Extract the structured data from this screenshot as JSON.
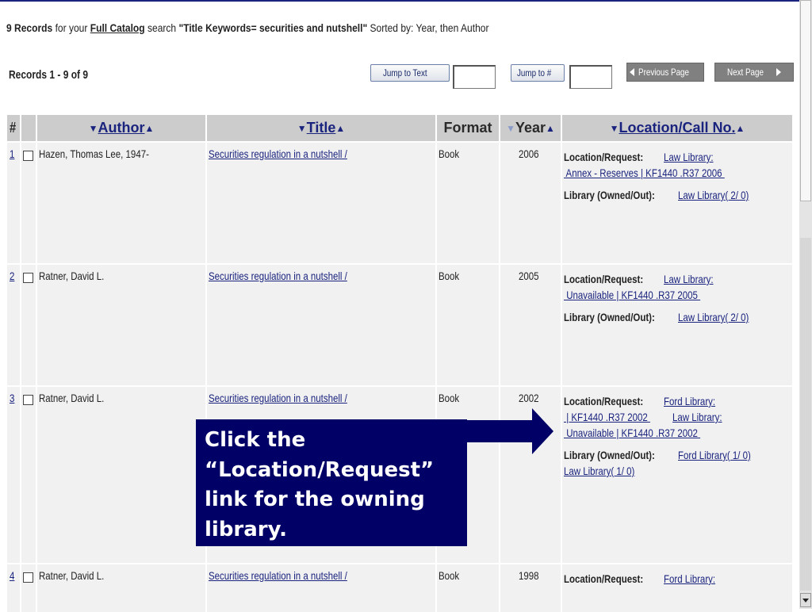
{
  "summary": {
    "count": "9 Records",
    "for_your": "for your",
    "catalog": "Full Catalog",
    "search": "search",
    "query": "\"Title Keywords= securities and nutshell\"",
    "sorted": "Sorted by: Year, then Author"
  },
  "records_range": "Records 1 - 9 of 9",
  "controls": {
    "jump_text": "Jump to Text",
    "jump_num": "Jump to #",
    "prev": "Previous Page",
    "next": "Next Page"
  },
  "headers": {
    "num": "#",
    "author": "Author",
    "title": "Title",
    "format": "Format",
    "year": "Year",
    "location": "Location/Call No."
  },
  "rows": [
    {
      "num": "1",
      "author": "Hazen, Thomas Lee, 1947-",
      "title": "Securities regulation in a nutshell /",
      "format": "Book",
      "year": "2006",
      "loc_label": "Location/Request:",
      "loc_links": [
        "Law Library:",
        " Annex - Reserves | KF1440 .R37 2006 "
      ],
      "owned_label": "Library (Owned/Out):",
      "owned_links": [
        "Law Library( 2/ 0)"
      ]
    },
    {
      "num": "2",
      "author": "Ratner, David L.",
      "title": "Securities regulation in a nutshell /",
      "format": "Book",
      "year": "2005",
      "loc_label": "Location/Request:",
      "loc_links": [
        "Law Library:",
        " Unavailable | KF1440 .R37 2005 "
      ],
      "owned_label": "Library (Owned/Out):",
      "owned_links": [
        "Law Library( 2/ 0)"
      ]
    },
    {
      "num": "3",
      "author": "Ratner, David L.",
      "title": "Securities regulation in a nutshell /",
      "format": "Book",
      "year": "2002",
      "loc_label": "Location/Request:",
      "loc_links": [
        "Ford Library:",
        " | KF1440 .R37 2002 ",
        "Law Library:",
        " Unavailable | KF1440 .R37 2002 "
      ],
      "owned_label": "Library (Owned/Out):",
      "owned_links": [
        "Ford Library( 1/ 0)",
        "Law Library( 1/ 0)"
      ]
    },
    {
      "num": "4",
      "author": "Ratner, David L.",
      "title": "Securities regulation in a nutshell /",
      "format": "Book",
      "year": "1998",
      "loc_label": "Location/Request:",
      "loc_links": [
        "Ford Library:"
      ],
      "owned_label": "",
      "owned_links": []
    }
  ],
  "callout": {
    "lines": [
      "Click the",
      "“Location/Request”",
      "link for the owning",
      "library."
    ]
  },
  "colors": {
    "accent": "#1a237e",
    "callout_bg": "#000066",
    "header_bg": "#cccccc",
    "row_bg": "#f1f1f1"
  }
}
